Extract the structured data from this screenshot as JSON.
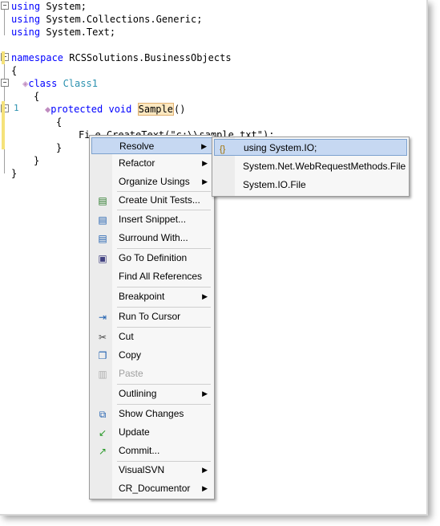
{
  "code": {
    "lines": [
      {
        "kw": "using",
        "rest": " System;"
      },
      {
        "kw": "using",
        "rest": " System.Collections.Generic;"
      },
      {
        "kw": "using",
        "rest": " System.Text;"
      },
      {
        "kw": "namespace",
        "rest": " RCSSolutions.BusinessObjects"
      },
      {
        "text": "{"
      },
      {
        "kw": "class",
        "type": " Class1"
      },
      {
        "text": "{"
      },
      {
        "kw": "protected void",
        "rest": " ",
        "method": "Sample",
        "paren": "()"
      },
      {
        "text": "{"
      },
      {
        "text": "Fi",
        "rest2": "e.CreateText(\"c:\\\\sample.txt\");"
      },
      {
        "text": "}"
      },
      {
        "text": "}"
      },
      {
        "text": "}"
      }
    ],
    "line_number": "1"
  },
  "context_menu": {
    "items": [
      {
        "label": "Resolve",
        "submenu": true,
        "highlighted": true
      },
      {
        "label": "Refactor",
        "submenu": true
      },
      {
        "label": "Organize Usings",
        "submenu": true
      },
      {
        "label": "Create Unit Tests...",
        "icon": "unit-test-icon"
      },
      {
        "label": "Insert Snippet...",
        "icon": "insert-snippet-icon"
      },
      {
        "label": "Surround With...",
        "icon": "surround-with-icon"
      },
      {
        "label": "Go To Definition",
        "icon": "go-to-definition-icon"
      },
      {
        "label": "Find All References"
      },
      {
        "label": "Breakpoint",
        "submenu": true
      },
      {
        "label": "Run To Cursor",
        "icon": "run-to-cursor-icon"
      },
      {
        "label": "Cut",
        "icon": "cut-icon"
      },
      {
        "label": "Copy",
        "icon": "copy-icon"
      },
      {
        "label": "Paste",
        "icon": "paste-icon",
        "disabled": true
      },
      {
        "label": "Outlining",
        "submenu": true
      },
      {
        "label": "Show Changes",
        "icon": "show-changes-icon"
      },
      {
        "label": "Update",
        "icon": "update-icon"
      },
      {
        "label": "Commit...",
        "icon": "commit-icon"
      },
      {
        "label": "VisualSVN",
        "submenu": true
      },
      {
        "label": "CR_Documentor",
        "submenu": true
      }
    ]
  },
  "resolve_submenu": {
    "items": [
      {
        "label": "using System.IO;",
        "highlighted": true
      },
      {
        "label": "System.Net.WebRequestMethods.File"
      },
      {
        "label": "System.IO.File"
      }
    ]
  }
}
